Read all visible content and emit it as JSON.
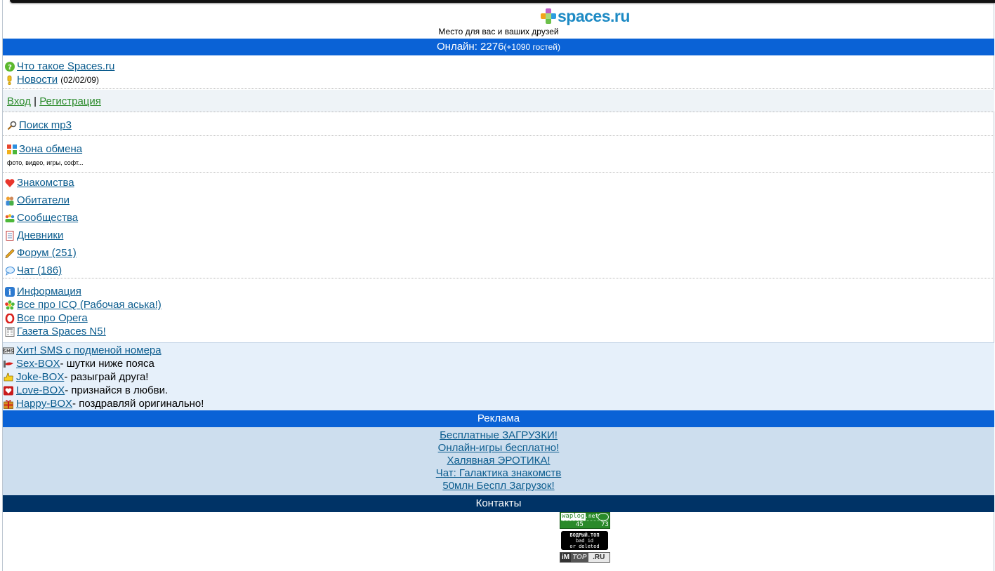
{
  "header": {
    "logo_text": "spaces.ru",
    "tagline": "Место для вас и ваших друзей"
  },
  "online_bar": {
    "label": "Онлайн: 2276",
    "guests": "(+1090 гостей)"
  },
  "info_links": [
    {
      "label": "Что такое Spaces.ru",
      "icon": "question-icon"
    },
    {
      "label": "Новости",
      "extra": "(02/02/09)",
      "icon": "exclamation-icon"
    }
  ],
  "auth": {
    "login": "Вход",
    "separator": "|",
    "register": "Регистрация"
  },
  "mp3": {
    "label": "Поиск mp3",
    "icon": "search-icon"
  },
  "exchange": {
    "label": "Зона обмена",
    "sub": "фото, видео, игры, софт...",
    "icon": "grid-icon"
  },
  "community": [
    {
      "label": "Знакомства",
      "icon": "heart-icon"
    },
    {
      "label": "Обитатели",
      "icon": "people-icon"
    },
    {
      "label": "Сообщества",
      "icon": "group-icon"
    },
    {
      "label": "Дневники",
      "icon": "notebook-icon"
    },
    {
      "label": "Форум (251)",
      "icon": "pencil-icon"
    },
    {
      "label": "Чат (186)",
      "icon": "speech-bubble-icon"
    }
  ],
  "extra_links": [
    {
      "label": "Информация",
      "icon": "info-icon"
    },
    {
      "label": "Все про ICQ (Рабочая аська!)",
      "icon": "icq-flower-icon"
    },
    {
      "label": "Все про Opera",
      "icon": "opera-icon"
    },
    {
      "label": "Газета Spaces N5!",
      "icon": "newspaper-icon"
    }
  ],
  "promo": [
    {
      "label": "Хит! SMS с подменой номера",
      "desc": "",
      "icon": "sms-icon"
    },
    {
      "label": "Sex-BOX",
      "desc": " - шутки ниже пояса",
      "icon": "lips-icon"
    },
    {
      "label": "Joke-BOX",
      "desc": " - разыграй друга!",
      "icon": "thumb-icon"
    },
    {
      "label": "Love-BOX",
      "desc": " - признайся в любви.",
      "icon": "love-card-icon"
    },
    {
      "label": "Happy-BOX",
      "desc": " - поздравляй оригинально!",
      "icon": "gift-icon"
    }
  ],
  "ads_bar": {
    "title": "Реклама"
  },
  "ads": [
    "Бесплатные ЗАГРУЗКИ!",
    "Онлайн-игры бесплатно!",
    "Халявная ЭРОТИКА!",
    "Чат: Галактика знакомств",
    "50млн Беспл Загрузок!"
  ],
  "contacts_bar": {
    "title": "Контакты"
  },
  "counters": {
    "waplog": {
      "name": "waplog",
      "tld": ".net",
      "left": "45",
      "right": "73"
    },
    "bodryi": {
      "line1": "БОДРЫЙ.ТОП",
      "line2": "bad id",
      "line3": "or deleted"
    },
    "imtop": {
      "left": "iM",
      "mid": "TOP",
      "right": ".RU"
    }
  },
  "colors": {
    "bar_blue": "#0a62d6",
    "bar_navy": "#003366",
    "ads_bg": "#cddeee",
    "promo_bg": "#e6f0fa",
    "link": "#0b5c8e",
    "auth_link": "#2a8a2a"
  }
}
